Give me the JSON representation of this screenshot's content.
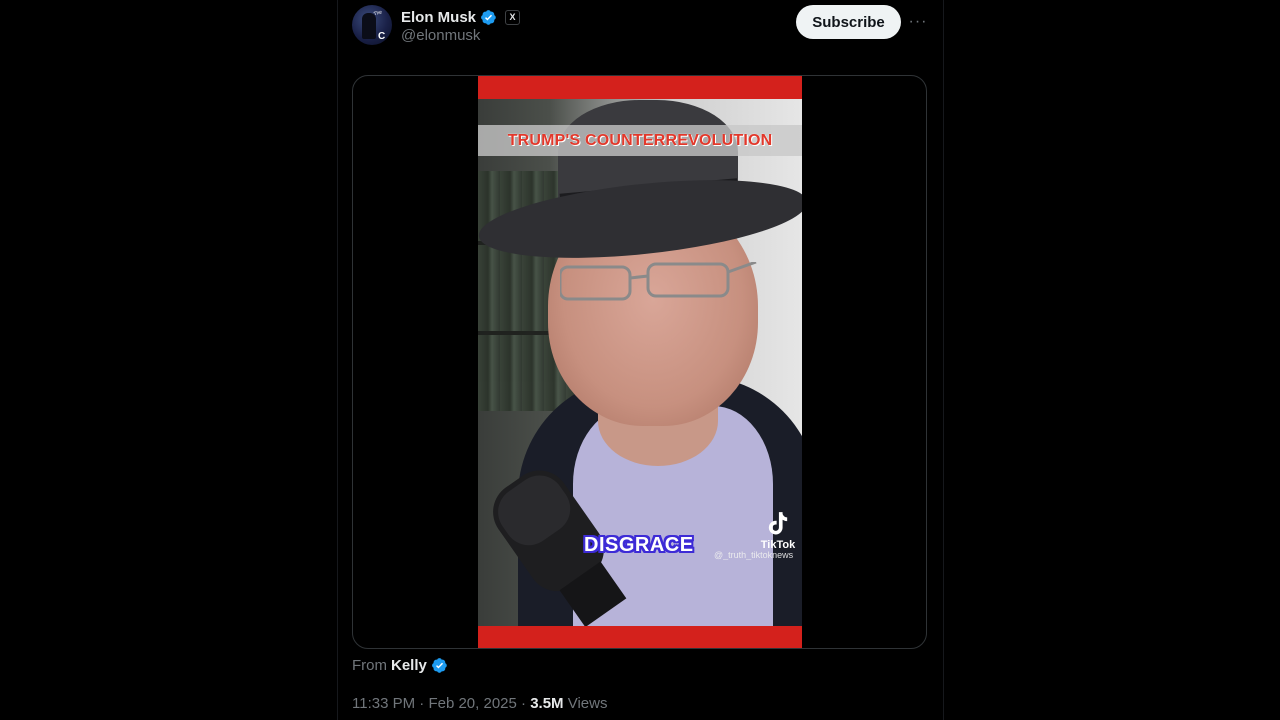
{
  "post": {
    "author": {
      "display_name": "Elon Musk",
      "handle": "@elonmusk",
      "verified": true,
      "affiliate_badge": "X",
      "verified_color": "#1d9bf0"
    },
    "subscribe_label": "Subscribe",
    "more_label": "···",
    "media": {
      "video_title": "TRUMP'S COUNTERREVOLUTION",
      "caption_word": "DISGRACE",
      "watermark_brand": "TikTok",
      "watermark_user": "@_truth_tiktoknews"
    },
    "source": {
      "prefix": "From",
      "name": "Kelly",
      "verified": true
    },
    "meta": {
      "time": "11:33 PM",
      "sep1": " · ",
      "date": "Feb 20, 2025",
      "sep2": " · ",
      "views_count": "3.5M",
      "views_label": " Views"
    }
  },
  "colors": {
    "background": "#000000",
    "text_primary": "#e7e9ea",
    "text_secondary": "#71767b",
    "accent_red": "#d4211c",
    "caption_outline": "#3d2bd6"
  }
}
